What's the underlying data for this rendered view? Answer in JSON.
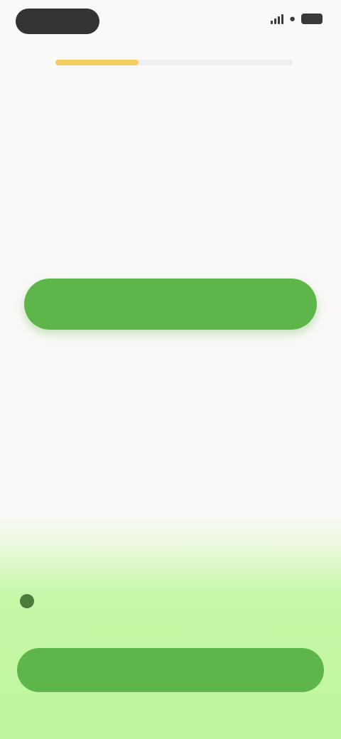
{
  "status_bar": {
    "time": "",
    "icons": [
      "signal-icon",
      "wifi-icon",
      "battery-icon"
    ]
  },
  "progress": {
    "value": 0.35,
    "skip_label": ""
  },
  "question": {
    "text": ""
  },
  "options": [
    {
      "label": "",
      "selected": false
    },
    {
      "label": "",
      "selected": true
    },
    {
      "label": "",
      "selected": false
    },
    {
      "label": "",
      "selected": false
    }
  ],
  "bottom_panel": {
    "tip_icon": "info-icon",
    "tip_title": "",
    "tip_text": "",
    "continue_label": ""
  },
  "colors": {
    "accent_green": "#5eb54a",
    "progress_yellow": "#f1cf63",
    "background_light": "#fbf9f8",
    "background_green": "#bff59f"
  }
}
